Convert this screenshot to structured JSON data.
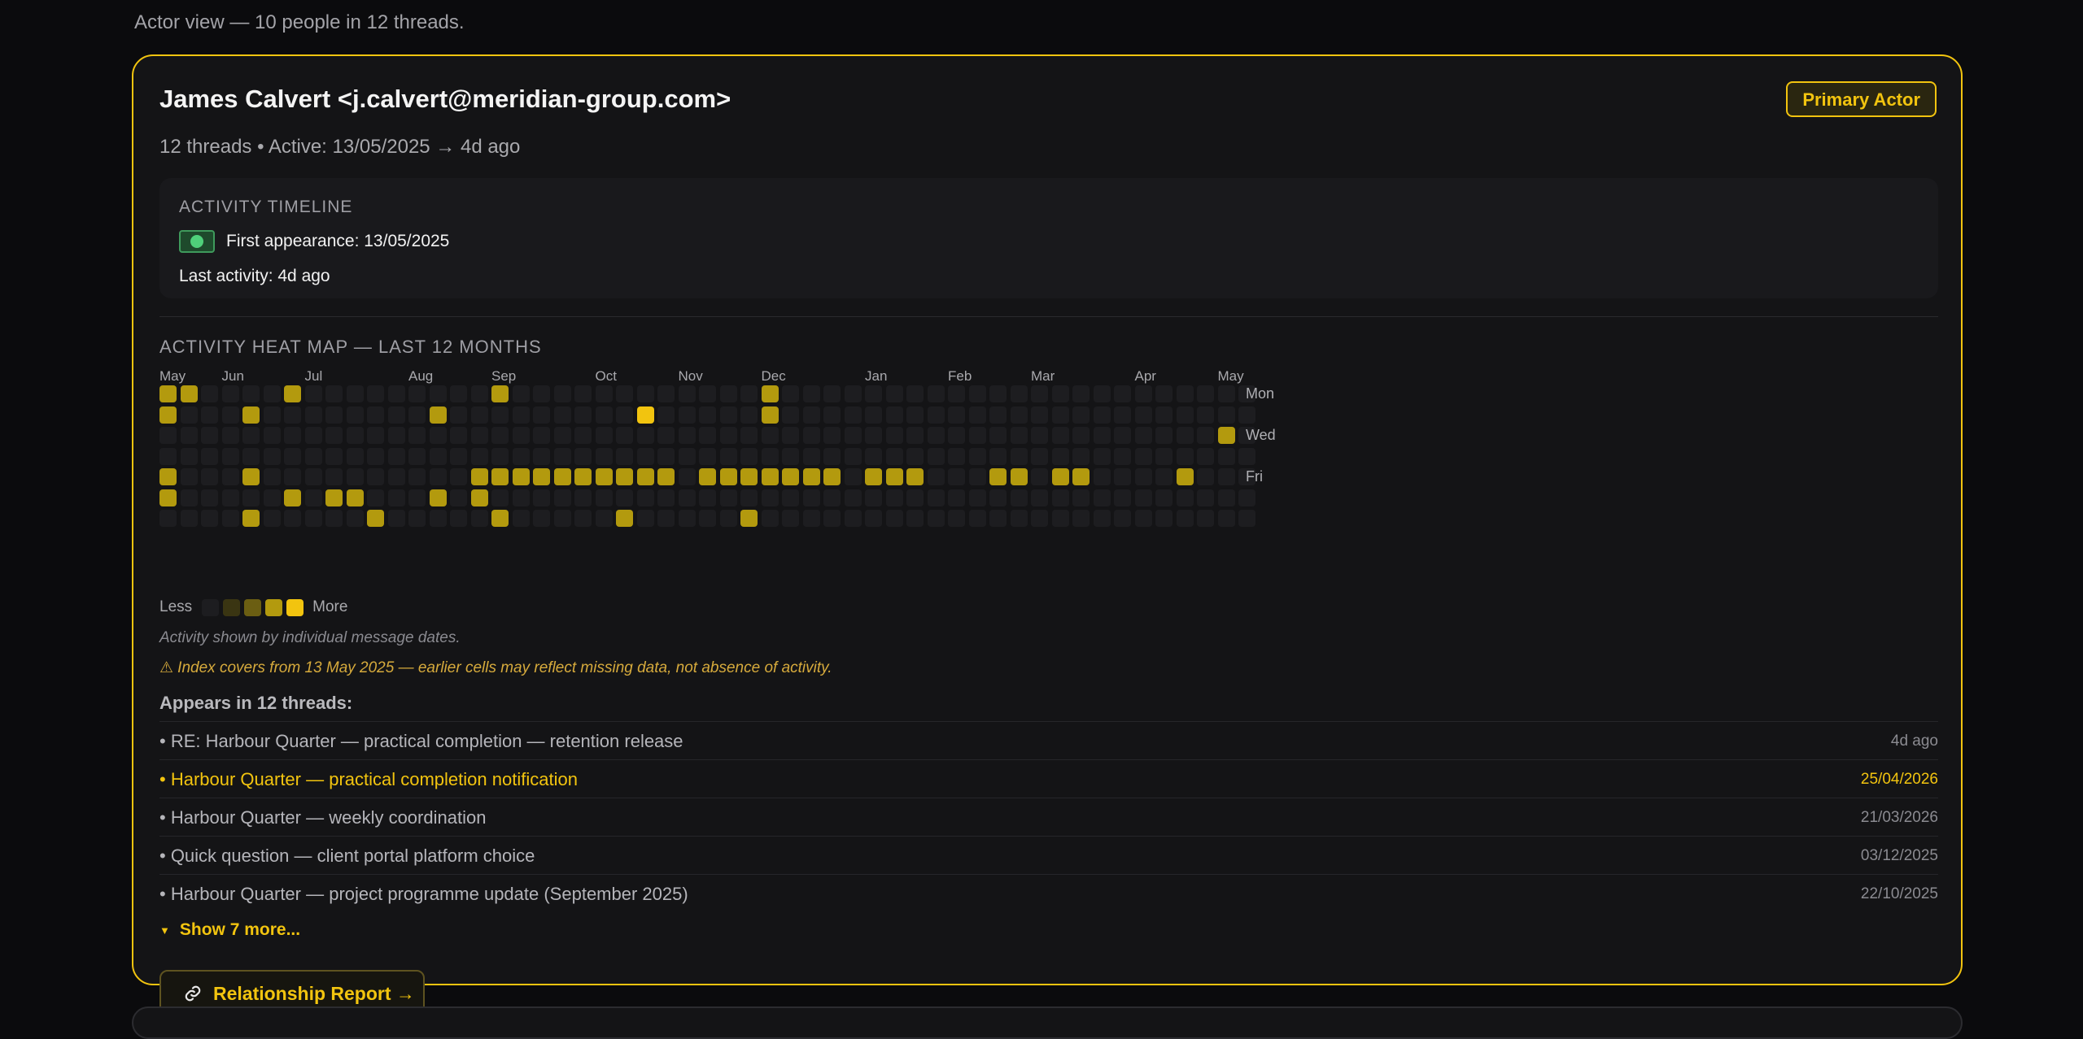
{
  "page": {
    "subtitle": "Actor view — 10 people in 12 threads."
  },
  "actor": {
    "name": "James Calvert <j.calvert@meridian-group.com>",
    "badge": "Primary Actor",
    "meta": "12 threads • Active: 13/05/2025 → 4d ago"
  },
  "timeline": {
    "title": "ACTIVITY TIMELINE",
    "first_appearance": "First appearance: 13/05/2025",
    "last_activity": "Last activity: 4d ago"
  },
  "heatmap": {
    "title": "ACTIVITY HEAT MAP — LAST 12 MONTHS",
    "months": [
      {
        "label": "May",
        "week": 0
      },
      {
        "label": "Jun",
        "week": 3
      },
      {
        "label": "Jul",
        "week": 7
      },
      {
        "label": "Aug",
        "week": 12
      },
      {
        "label": "Sep",
        "week": 16
      },
      {
        "label": "Oct",
        "week": 21
      },
      {
        "label": "Nov",
        "week": 25
      },
      {
        "label": "Dec",
        "week": 29
      },
      {
        "label": "Jan",
        "week": 34
      },
      {
        "label": "Feb",
        "week": 38
      },
      {
        "label": "Mar",
        "week": 42
      },
      {
        "label": "Apr",
        "week": 47
      },
      {
        "label": "May",
        "week": 51
      }
    ],
    "day_labels": [
      {
        "label": "Mon",
        "row": 0
      },
      {
        "label": "Wed",
        "row": 2
      },
      {
        "label": "Fri",
        "row": 4
      }
    ],
    "weeks": 52,
    "active_cells": [
      {
        "w": 0,
        "d": 0,
        "l": 3
      },
      {
        "w": 1,
        "d": 0,
        "l": 3
      },
      {
        "w": 6,
        "d": 0,
        "l": 3
      },
      {
        "w": 16,
        "d": 0,
        "l": 3
      },
      {
        "w": 29,
        "d": 0,
        "l": 3
      },
      {
        "w": 0,
        "d": 1,
        "l": 3
      },
      {
        "w": 4,
        "d": 1,
        "l": 3
      },
      {
        "w": 13,
        "d": 1,
        "l": 3
      },
      {
        "w": 23,
        "d": 1,
        "l": 4
      },
      {
        "w": 29,
        "d": 1,
        "l": 3
      },
      {
        "w": 51,
        "d": 2,
        "l": 3
      },
      {
        "w": 0,
        "d": 4,
        "l": 3
      },
      {
        "w": 4,
        "d": 4,
        "l": 3
      },
      {
        "w": 15,
        "d": 4,
        "l": 3
      },
      {
        "w": 16,
        "d": 4,
        "l": 3
      },
      {
        "w": 17,
        "d": 4,
        "l": 3
      },
      {
        "w": 18,
        "d": 4,
        "l": 3
      },
      {
        "w": 19,
        "d": 4,
        "l": 3
      },
      {
        "w": 20,
        "d": 4,
        "l": 3
      },
      {
        "w": 21,
        "d": 4,
        "l": 3
      },
      {
        "w": 22,
        "d": 4,
        "l": 3
      },
      {
        "w": 23,
        "d": 4,
        "l": 3
      },
      {
        "w": 24,
        "d": 4,
        "l": 3
      },
      {
        "w": 26,
        "d": 4,
        "l": 3
      },
      {
        "w": 27,
        "d": 4,
        "l": 3
      },
      {
        "w": 28,
        "d": 4,
        "l": 3
      },
      {
        "w": 29,
        "d": 4,
        "l": 3
      },
      {
        "w": 30,
        "d": 4,
        "l": 3
      },
      {
        "w": 31,
        "d": 4,
        "l": 3
      },
      {
        "w": 32,
        "d": 4,
        "l": 3
      },
      {
        "w": 34,
        "d": 4,
        "l": 3
      },
      {
        "w": 35,
        "d": 4,
        "l": 3
      },
      {
        "w": 36,
        "d": 4,
        "l": 3
      },
      {
        "w": 40,
        "d": 4,
        "l": 3
      },
      {
        "w": 41,
        "d": 4,
        "l": 3
      },
      {
        "w": 43,
        "d": 4,
        "l": 3
      },
      {
        "w": 44,
        "d": 4,
        "l": 3
      },
      {
        "w": 49,
        "d": 4,
        "l": 3
      },
      {
        "w": 0,
        "d": 5,
        "l": 3
      },
      {
        "w": 6,
        "d": 5,
        "l": 3
      },
      {
        "w": 8,
        "d": 5,
        "l": 3
      },
      {
        "w": 9,
        "d": 5,
        "l": 3
      },
      {
        "w": 13,
        "d": 5,
        "l": 3
      },
      {
        "w": 15,
        "d": 5,
        "l": 3
      },
      {
        "w": 4,
        "d": 6,
        "l": 3
      },
      {
        "w": 10,
        "d": 6,
        "l": 3
      },
      {
        "w": 16,
        "d": 6,
        "l": 3
      },
      {
        "w": 22,
        "d": 6,
        "l": 3
      },
      {
        "w": 28,
        "d": 6,
        "l": 3
      }
    ],
    "legend_less": "Less",
    "legend_more": "More",
    "colors": {
      "empty": "#1d1d20",
      "l1": "#3a3512",
      "l2": "#6b5e12",
      "l3": "#b39a0e",
      "l4": "#f2c40f"
    }
  },
  "notes": {
    "activity": "Activity shown by individual message dates.",
    "index_warning": "⚠ Index covers from 13 May 2025 — earlier cells may reflect missing data, not absence of activity."
  },
  "threads": {
    "heading": "Appears in 12 threads:",
    "items": [
      {
        "title": "• RE: Harbour Quarter — practical completion — retention release",
        "date": "4d ago",
        "highlight": false
      },
      {
        "title": "• Harbour Quarter — practical completion notification",
        "date": "25/04/2026",
        "highlight": true
      },
      {
        "title": "• Harbour Quarter — weekly coordination",
        "date": "21/03/2026",
        "highlight": false
      },
      {
        "title": "• Quick question — client portal platform choice",
        "date": "03/12/2025",
        "highlight": false
      },
      {
        "title": "• Harbour Quarter — project programme update (September 2025)",
        "date": "22/10/2025",
        "highlight": false
      }
    ],
    "show_more": "Show 7 more..."
  },
  "report_button": "Relationship Report →"
}
